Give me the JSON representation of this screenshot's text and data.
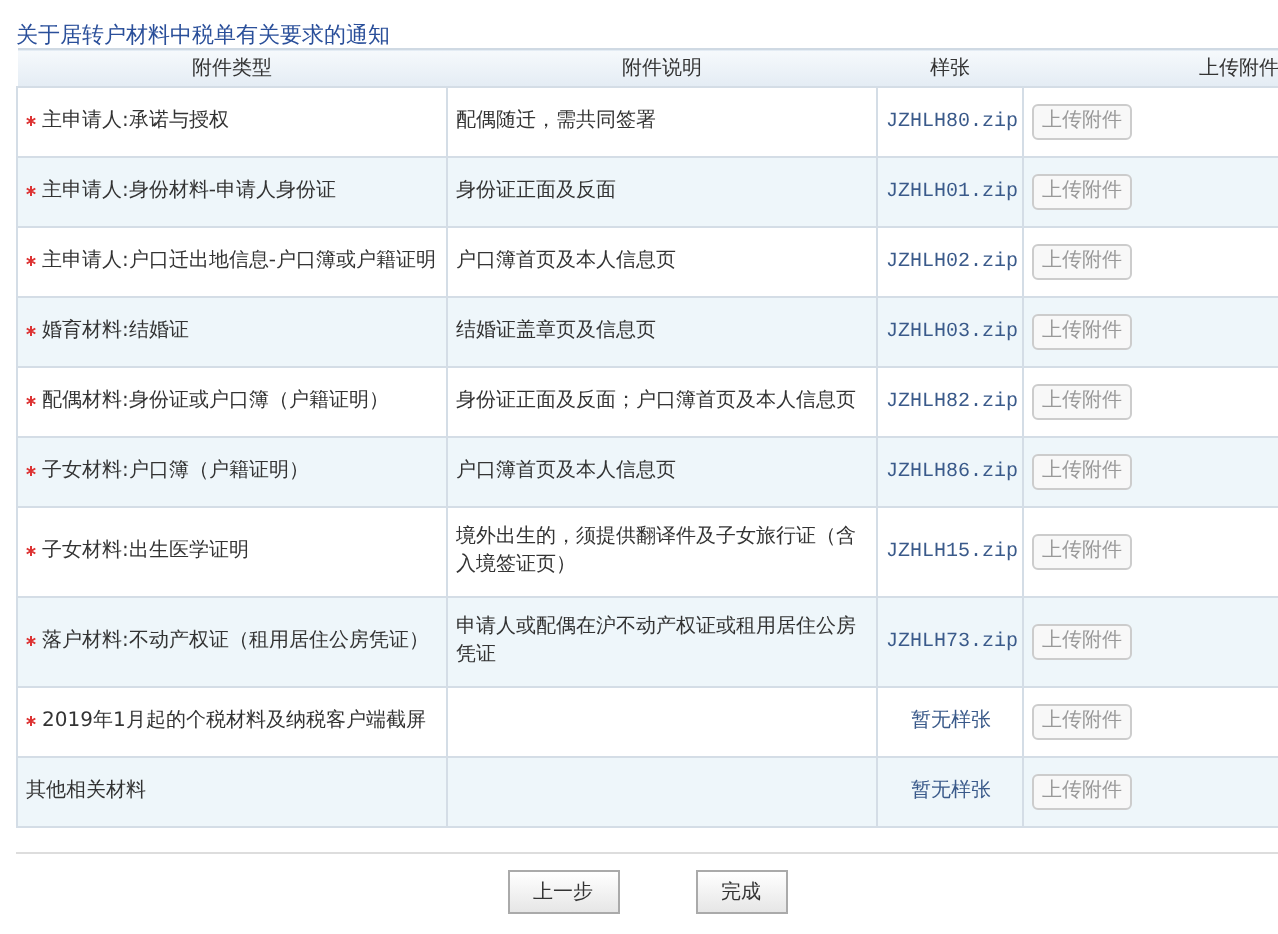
{
  "title": "关于居转户材料中税单有关要求的通知",
  "table": {
    "columns": [
      "附件类型",
      "附件说明",
      "样张",
      "上传附件"
    ],
    "rows": [
      {
        "required": true,
        "type": "主申请人:承诺与授权",
        "description": "配偶随迁，需共同签署",
        "sample": {
          "kind": "file",
          "text": "JZHLH80.zip"
        },
        "upload": "上传附件"
      },
      {
        "required": true,
        "type": "主申请人:身份材料-申请人身份证",
        "description": "身份证正面及反面",
        "sample": {
          "kind": "file",
          "text": "JZHLH01.zip"
        },
        "upload": "上传附件"
      },
      {
        "required": true,
        "type": "主申请人:户口迁出地信息-户口簿或户籍证明",
        "description": "户口簿首页及本人信息页",
        "sample": {
          "kind": "file",
          "text": "JZHLH02.zip"
        },
        "upload": "上传附件"
      },
      {
        "required": true,
        "type": "婚育材料:结婚证",
        "description": "结婚证盖章页及信息页",
        "sample": {
          "kind": "file",
          "text": "JZHLH03.zip"
        },
        "upload": "上传附件"
      },
      {
        "required": true,
        "type": "配偶材料:身份证或户口簿（户籍证明）",
        "description": "身份证正面及反面；户口簿首页及本人信息页",
        "sample": {
          "kind": "file",
          "text": "JZHLH82.zip"
        },
        "upload": "上传附件"
      },
      {
        "required": true,
        "type": "子女材料:户口簿（户籍证明）",
        "description": "户口簿首页及本人信息页",
        "sample": {
          "kind": "file",
          "text": "JZHLH86.zip"
        },
        "upload": "上传附件"
      },
      {
        "required": true,
        "type": "子女材料:出生医学证明",
        "description": "境外出生的，须提供翻译件及子女旅行证（含入境签证页）",
        "sample": {
          "kind": "file",
          "text": "JZHLH15.zip"
        },
        "upload": "上传附件"
      },
      {
        "required": true,
        "type": "落户材料:不动产权证（租用居住公房凭证）",
        "description": "申请人或配偶在沪不动产权证或租用居住公房凭证",
        "sample": {
          "kind": "file",
          "text": "JZHLH73.zip"
        },
        "upload": "上传附件"
      },
      {
        "required": true,
        "type": "2019年1月起的个税材料及纳税客户端截屏",
        "sample": {
          "kind": "none",
          "text": "暂无样张"
        },
        "upload": "上传附件"
      },
      {
        "required": false,
        "type": "其他相关材料",
        "sample": {
          "kind": "none",
          "text": "暂无样张"
        },
        "upload": "上传附件"
      }
    ]
  },
  "buttons": [
    "上一步",
    "完成"
  ]
}
